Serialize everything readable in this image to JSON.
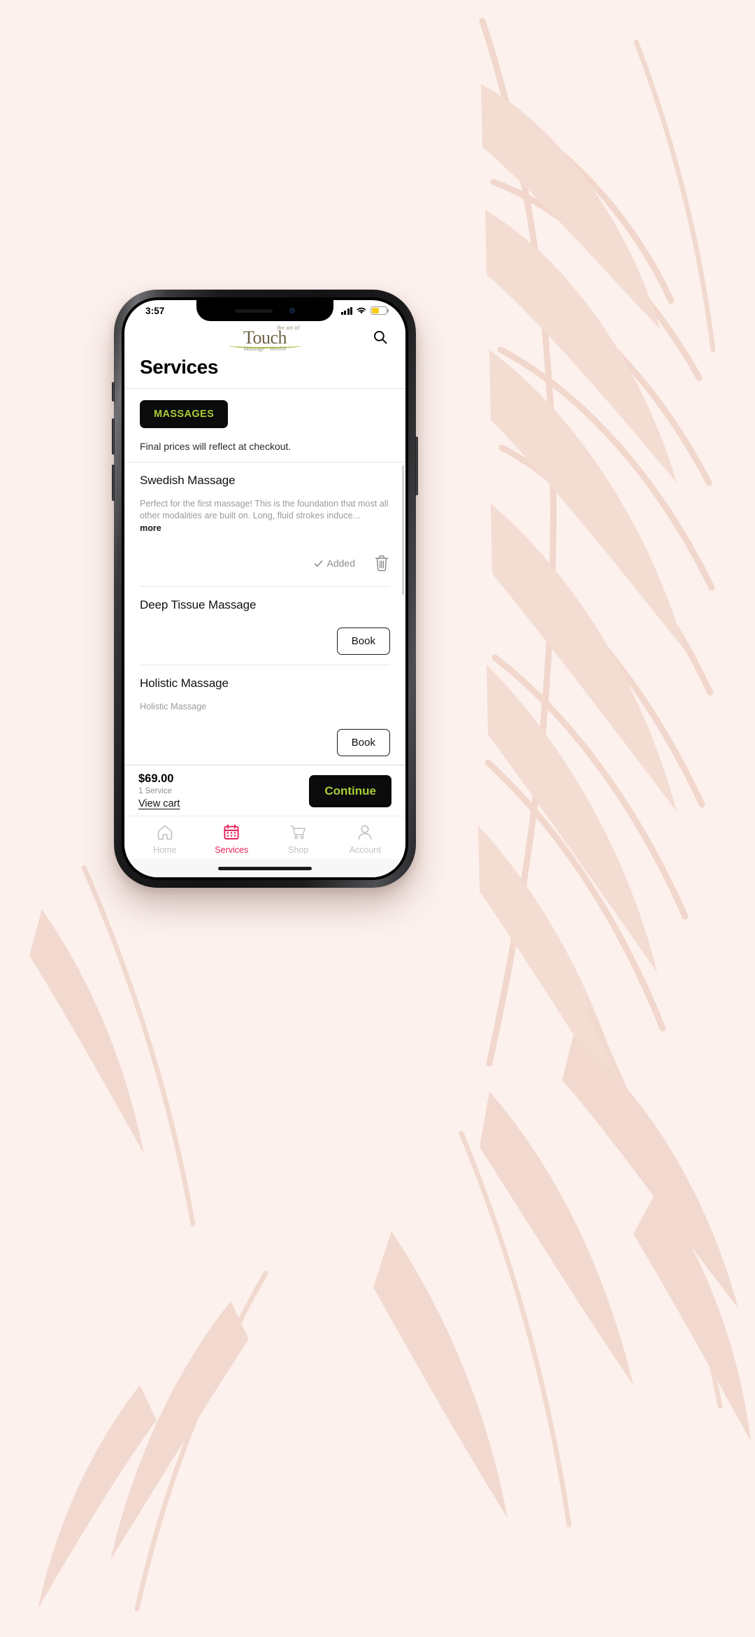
{
  "statusbar": {
    "time": "3:57",
    "signal_icon": "cellular-signal-icon",
    "wifi_icon": "wifi-icon",
    "battery_icon": "battery-icon",
    "battery_level_pct": 52,
    "battery_color": "#f7cc15"
  },
  "header": {
    "logo": {
      "line_top": "the art of",
      "line_main": "Touch",
      "line_sub": "Massage · Health",
      "main_color": "#6f6346",
      "swoosh_color": "#a9c44a"
    },
    "search_icon": "search-icon"
  },
  "page": {
    "title": "Services"
  },
  "category": {
    "chip_label": "MASSAGES",
    "chip_bg": "#0b0b0b",
    "chip_text_color": "#a9cc3a",
    "notice": "Final prices will reflect at checkout."
  },
  "services": [
    {
      "name": "Swedish Massage",
      "description": "Perfect for the first massage!  This is the foundation that most all other modalities are built on.  Long, fluid strokes induce...",
      "more_label": "more",
      "state": "added",
      "added_label": "Added",
      "added_check_icon": "check-icon",
      "delete_icon": "trash-icon"
    },
    {
      "name": "Deep Tissue Massage",
      "description": "",
      "state": "bookable",
      "book_label": "Book"
    },
    {
      "name": "Holistic Massage",
      "description": "Holistic Massage",
      "state": "bookable",
      "book_label": "Book"
    }
  ],
  "cart": {
    "total": "$69.00",
    "count_label": "1 Service",
    "view_cart_label": "View cart",
    "continue_label": "Continue",
    "continue_bg": "#0b0b0b",
    "continue_text_color": "#a9cc3a"
  },
  "tabbar": {
    "active_color": "#e8215a",
    "inactive_color": "#c4c4c6",
    "items": [
      {
        "label": "Home",
        "icon": "home-icon",
        "active": false
      },
      {
        "label": "Services",
        "icon": "calendar-icon",
        "active": true
      },
      {
        "label": "Shop",
        "icon": "shopping-cart-icon",
        "active": false
      },
      {
        "label": "Account",
        "icon": "person-icon",
        "active": false
      }
    ]
  },
  "backdrop": {
    "background_color": "#fdf1ed",
    "motif_color": "#f3dbd1",
    "motif": "botanical-leaves"
  }
}
